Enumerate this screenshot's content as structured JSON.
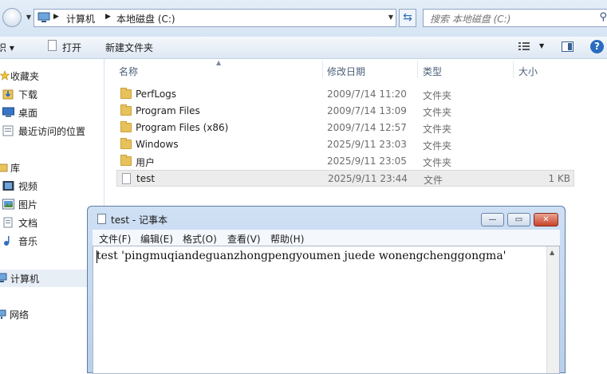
{
  "address": {
    "breadcrumbs": [
      "计算机",
      "本地磁盘 (C:)"
    ],
    "search_placeholder": "搜索 本地磁盘 (C:)"
  },
  "toolbar": {
    "organize": "织 ▾",
    "open": "打开",
    "new_folder": "新建文件夹"
  },
  "navigation": {
    "favorites": "收藏夹",
    "downloads": "下载",
    "desktop": "桌面",
    "recent": "最近访问的位置",
    "libraries": "库",
    "videos": "视频",
    "pictures": "图片",
    "documents": "文档",
    "music": "音乐",
    "computer": "计算机",
    "network": "网络"
  },
  "columns": {
    "name": "名称",
    "date": "修改日期",
    "type": "类型",
    "size": "大小"
  },
  "files": [
    {
      "name": "PerfLogs",
      "date": "2009/7/14 11:20",
      "type": "文件夹",
      "size": ""
    },
    {
      "name": "Program Files",
      "date": "2009/7/14 13:09",
      "type": "文件夹",
      "size": ""
    },
    {
      "name": "Program Files (x86)",
      "date": "2009/7/14 12:57",
      "type": "文件夹",
      "size": ""
    },
    {
      "name": "Windows",
      "date": "2025/9/11 23:03",
      "type": "文件夹",
      "size": ""
    },
    {
      "name": "用户",
      "date": "2025/9/11 23:05",
      "type": "文件夹",
      "size": ""
    },
    {
      "name": "test",
      "date": "2025/9/11 23:44",
      "type": "文件",
      "size": "1 KB"
    }
  ],
  "notepad": {
    "title": "test - 记事本",
    "menu": {
      "file": "文件(F)",
      "edit": "编辑(E)",
      "format": "格式(O)",
      "view": "查看(V)",
      "help": "帮助(H)"
    },
    "content": "test 'pingmuqiandeguanzhongpengyoumen juede wonengchenggongma'",
    "btn_min": "—",
    "btn_max": "▭",
    "btn_close": "✕"
  },
  "colors": {
    "accent": "#2a6bc1",
    "folder": "#e8c15a",
    "selected_row": "#ececec"
  }
}
